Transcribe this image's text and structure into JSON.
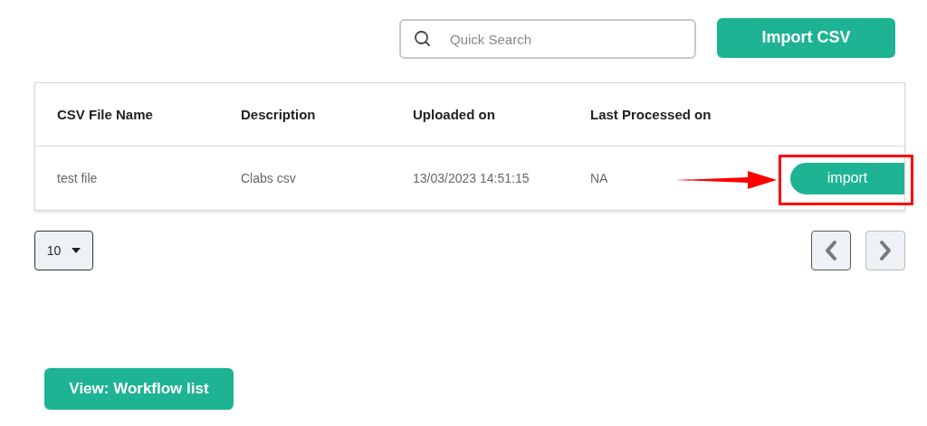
{
  "search": {
    "placeholder": "Quick Search"
  },
  "import_csv_button": "Import CSV",
  "table": {
    "columns": [
      "CSV File Name",
      "Description",
      "Uploaded on",
      "Last Processed on"
    ],
    "rows": [
      {
        "cells": [
          "test file",
          "Clabs csv",
          "13/03/2023 14:51:15",
          "NA"
        ],
        "action": "import"
      }
    ]
  },
  "page_size": "10",
  "pagination": [
    {
      "kind": "prev",
      "disabled": false
    },
    {
      "kind": "next",
      "disabled": true
    }
  ],
  "view_button": "View: Workflow list"
}
